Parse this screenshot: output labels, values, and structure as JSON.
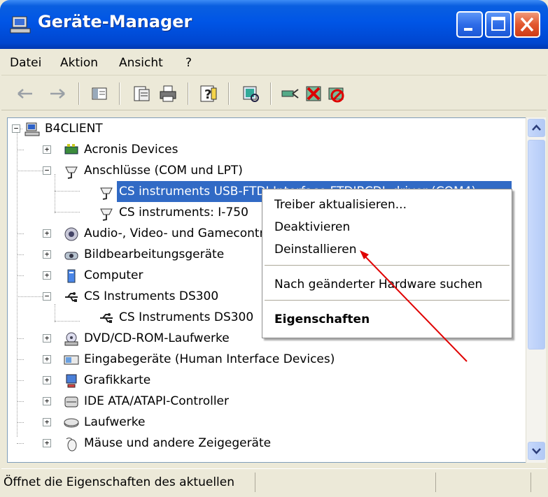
{
  "window": {
    "title": "Geräte-Manager",
    "colors": {
      "titlebar": "#0055e6",
      "selection": "#316ac5",
      "annotation_arrow": "#e00000"
    }
  },
  "menu": [
    "Datei",
    "Aktion",
    "Ansicht",
    "?"
  ],
  "toolbar": {
    "icons": [
      "back-arrow-icon",
      "forward-arrow-icon",
      "show-hide-console-tree-icon",
      "properties-icon",
      "print-icon",
      "help-icon",
      "scan-hardware-icon",
      "update-driver-icon",
      "uninstall-icon",
      "disable-icon"
    ]
  },
  "tree": {
    "root": "B4CLIENT",
    "items": [
      {
        "label": "Acronis Devices",
        "expander": "+"
      },
      {
        "label": "Anschlüsse (COM und LPT)",
        "expander": "−"
      },
      {
        "label": "CS instruments USB-FTDI Interface FTDIBCDL driver (COM4)"
      },
      {
        "label": "CS instruments: I-750"
      },
      {
        "label": "Audio-, Video- und Gamecontroller",
        "expander": "+"
      },
      {
        "label": "Bildbearbeitungsgeräte",
        "expander": "+"
      },
      {
        "label": "Computer",
        "expander": "+"
      },
      {
        "label": "CS Instruments DS300",
        "expander": "−"
      },
      {
        "label": "CS Instruments DS300"
      },
      {
        "label": "DVD/CD-ROM-Laufwerke",
        "expander": "+"
      },
      {
        "label": "Eingabegeräte (Human Interface Devices)",
        "expander": "+"
      },
      {
        "label": "Grafikkarte",
        "expander": "+"
      },
      {
        "label": "IDE ATA/ATAPI-Controller",
        "expander": "+"
      },
      {
        "label": "Laufwerke",
        "expander": "+"
      },
      {
        "label": "Mäuse und andere Zeigegeräte",
        "expander": "+"
      }
    ]
  },
  "context_menu": {
    "items": [
      "Treiber aktualisieren...",
      "Deaktivieren",
      "Deinstallieren",
      "Nach geänderter Hardware suchen",
      "Eigenschaften"
    ]
  },
  "status": {
    "text": "Öffnet die Eigenschaften des aktuellen Objekts."
  }
}
